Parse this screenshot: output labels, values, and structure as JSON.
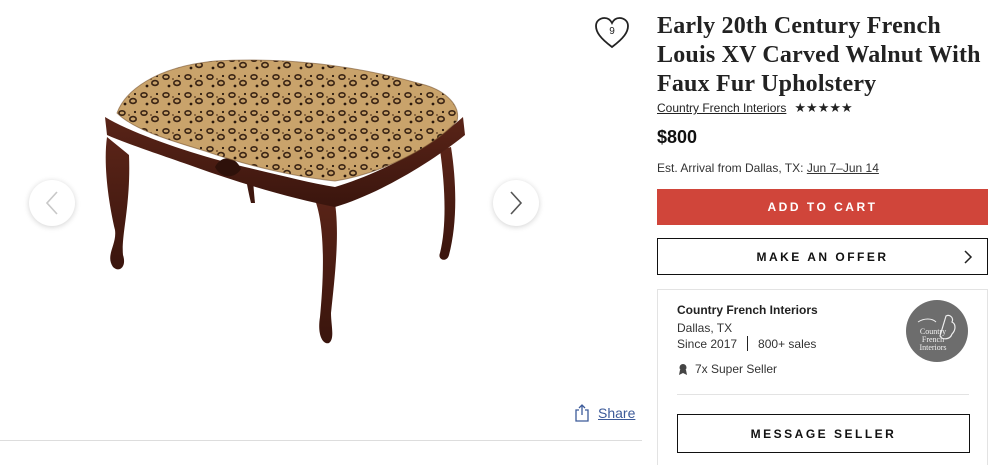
{
  "listing": {
    "title": "Early 20th Century French Louis XV Carved Walnut With Faux Fur Upholstery",
    "favorite_count": "9",
    "seller_link": "Country French Interiors",
    "rating_stars": "★★★★★",
    "price": "$800",
    "arrival_prefix": "Est. Arrival from Dallas, TX:",
    "arrival_dates": "Jun 7–Jun 14"
  },
  "actions": {
    "add_to_cart": "ADD TO CART",
    "make_offer": "MAKE AN OFFER",
    "share": "Share"
  },
  "seller_card": {
    "name": "Country French Interiors",
    "location": "Dallas, TX",
    "since": "Since 2017",
    "sales": "800+ sales",
    "super_seller": "7x Super Seller",
    "logo_text": "Country French Interiors",
    "message_button": "MESSAGE SELLER"
  },
  "icons": {
    "prev": "chevron-left-icon",
    "next": "chevron-right-icon",
    "favorite": "heart-icon",
    "share": "share-icon",
    "offer_chevron": "chevron-right-icon",
    "super_seller": "award-icon"
  },
  "colors": {
    "accent_cart": "#d0453a",
    "link_share": "#3c5a99",
    "logo_bg": "#6d6d6d"
  }
}
